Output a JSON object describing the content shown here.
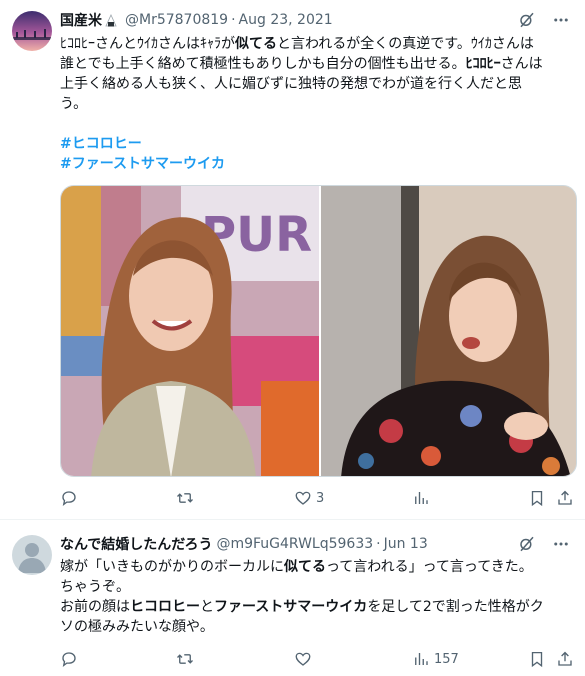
{
  "tweet1": {
    "author_name": "国産米",
    "handle": "@Mr57870819",
    "separator": "·",
    "date": "Aug 23, 2021",
    "body": {
      "l1a": "ﾋｺﾛﾋｰさんとｳｲｶさんはｷｬﾗが",
      "l1b": "似てる",
      "l1c": "と言われるが全くの真逆です。ｳｲｶさんは",
      "l2": "誰とでも上手く絡めて積極性もありしかも自分の個性も出せる。",
      "l2b": "ﾋｺﾛﾋｰ",
      "l2c": "さんは",
      "l3": "上手く絡める人も狭く、人に媚びずに独特の発想でわが道を行く人だと思",
      "l4": "う。"
    },
    "hashtags": [
      "#ヒコロヒー",
      "#ファーストサマーウイカ"
    ],
    "stats": {
      "replies": "",
      "retweets": "",
      "likes": "3",
      "views": ""
    }
  },
  "tweet2": {
    "author_name": "なんで結婚したんだろう",
    "handle": "@m9FuG4RWLq59633",
    "separator": "·",
    "date": "Jun 13",
    "body": {
      "l1a": "嫁が「いきものがかりのボーカルに",
      "l1b": "似てる",
      "l1c": "って言われる」って言ってきた。",
      "l2": "ちゃうぞ。",
      "l3a": "お前の顔は",
      "l3b": "ヒコロヒー",
      "l3c": "と",
      "l3d": "ファーストサマーウイカ",
      "l3e": "を足して2で割った性格がク",
      "l4": "ソの極みみたいな顔や。"
    },
    "stats": {
      "replies": "",
      "retweets": "",
      "likes": "",
      "views": "157"
    }
  },
  "media": {
    "left_sign_text": "PUR"
  },
  "colors": {
    "text": "#0f1419",
    "secondary": "#536471",
    "link": "#1d9bf0",
    "border": "#eff3f4"
  },
  "icons": [
    "grok-icon",
    "more-icon",
    "reply-icon",
    "retweet-icon",
    "like-icon",
    "views-icon",
    "bookmark-icon",
    "share-icon"
  ]
}
